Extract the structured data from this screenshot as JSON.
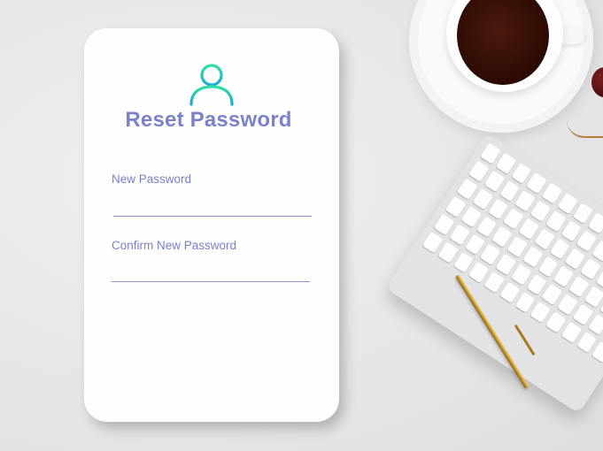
{
  "form": {
    "title": "Reset Password",
    "new_password_label": "New Password",
    "new_password_value": "",
    "confirm_password_label": "Confirm New Password",
    "confirm_password_value": ""
  },
  "icons": {
    "user": "user-icon"
  },
  "colors": {
    "accent": "#7c82c9",
    "icon_gradient_start": "#2fe0a0",
    "icon_gradient_end": "#1ea9d6",
    "card_background": "#fefefe"
  }
}
